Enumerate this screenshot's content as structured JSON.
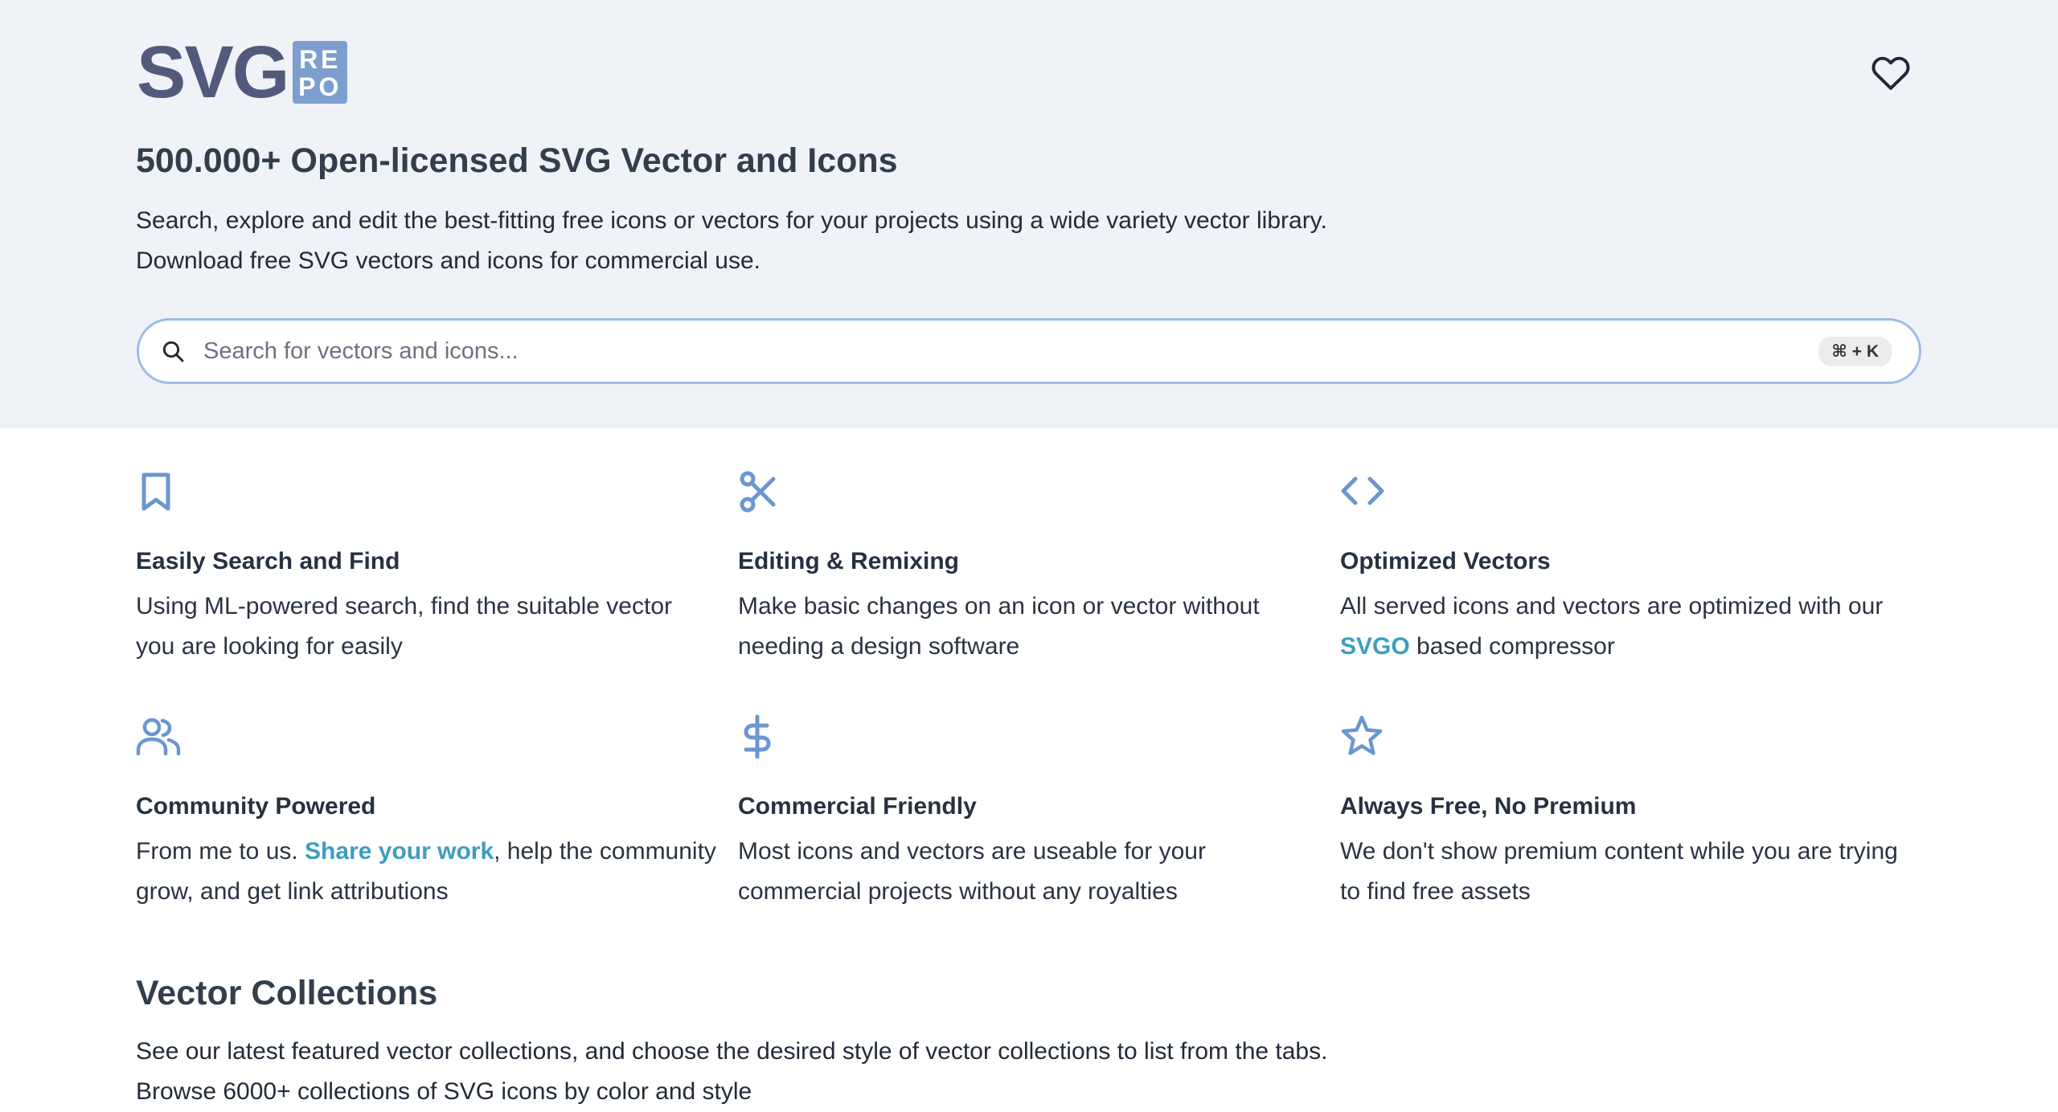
{
  "logo": {
    "wordmark": "SVG",
    "badge_line1": "RE",
    "badge_line2": "PO"
  },
  "header": {
    "favorites_icon": "heart-icon"
  },
  "hero": {
    "title": "500.000+ Open-licensed SVG Vector and Icons",
    "description_line1": "Search, explore and edit the best-fitting free icons or vectors for your projects using a wide variety vector library.",
    "description_line2": "Download free SVG vectors and icons for commercial use."
  },
  "search": {
    "placeholder": "Search for vectors and icons...",
    "value": "",
    "shortcut": "⌘ + K",
    "icon": "search-icon"
  },
  "features": [
    {
      "icon": "bookmark-icon",
      "title": "Easily Search and Find",
      "line1": "Using ML-powered search, find the suitable vector",
      "line2": "you are looking for easily"
    },
    {
      "icon": "scissors-icon",
      "title": "Editing & Remixing",
      "line1": "Make basic changes on an icon or vector without",
      "line2": "needing a design software"
    },
    {
      "icon": "code-icon",
      "title": "Optimized Vectors",
      "line1": "All served icons and vectors are optimized with our",
      "line2_link": "SVGO",
      "line2_rest": " based compressor"
    },
    {
      "icon": "users-icon",
      "title": "Community Powered",
      "line1_before": "From me to us. ",
      "line1_link": "Share your work",
      "line1_after": ", help the community",
      "line2": "grow, and get link attributions"
    },
    {
      "icon": "dollar-icon",
      "title": "Commercial Friendly",
      "line1": "Most icons and vectors are useable for your",
      "line2": "commercial projects without any royalties"
    },
    {
      "icon": "star-icon",
      "title": "Always Free, No Premium",
      "line1": "We don't show premium content while you are trying",
      "line2": "to find free assets"
    }
  ],
  "collections": {
    "title": "Vector Collections",
    "description_line1": "See our latest featured vector collections, and choose the desired style of vector collections to list from the tabs.",
    "description_line2": "Browse 6000+ collections of SVG icons by color and style"
  },
  "colors": {
    "hero_background": "#eff2f7",
    "accent_icon": "#6b97cf",
    "link": "#3d9dc0",
    "logo_text": "#525a7c",
    "logo_badge": "#7c9fce",
    "search_border": "#9dbce6"
  }
}
